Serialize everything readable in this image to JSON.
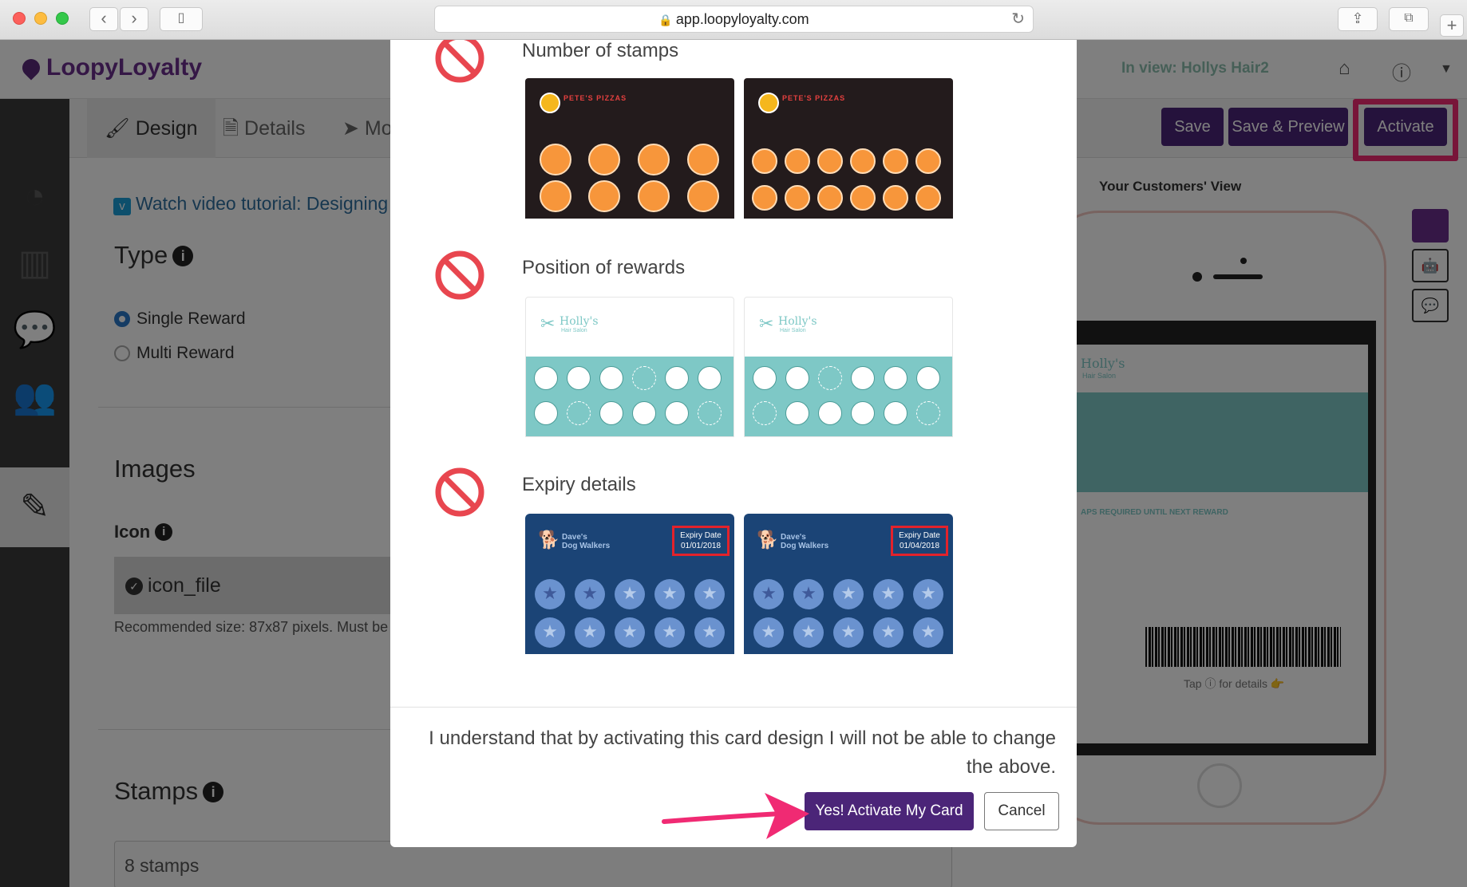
{
  "browser": {
    "url": "app.loopyloyalty.com"
  },
  "header": {
    "logo_text": "LoopyLoyalty",
    "in_view": "In view: Hollys Hair2"
  },
  "tabs": [
    {
      "label": "Design",
      "icon": "paintbrush-icon"
    },
    {
      "label": "Details",
      "icon": "document-icon"
    },
    {
      "label": "Mo",
      "icon": "navigation-arrow-icon"
    }
  ],
  "toolbar": {
    "save_label": "Save",
    "save_preview_label": "Save & Preview",
    "activate_label": "Activate"
  },
  "editor": {
    "watch_link": "Watch video tutorial: Designing",
    "type_heading": "Type",
    "radio_single": "Single Reward",
    "radio_multi": "Multi Reward",
    "images_heading": "Images",
    "icon_label": "Icon",
    "icon_file": "icon_file",
    "recommended": "Recommended size: 87x87 pixels. Must be s",
    "stamps_heading": "Stamps",
    "stamps_value": "8 stamps"
  },
  "preview": {
    "title": "Your Customers' View",
    "card_brand": "Holly's",
    "card_sub": "Hair Salon",
    "stamps_required": "APS REQUIRED UNTIL NEXT REWARD",
    "tap_text": "Tap ⓘ for details 👉"
  },
  "modal": {
    "sections": [
      {
        "title": "Number of stamps"
      },
      {
        "title": "Position of rewards"
      },
      {
        "title": "Expiry details"
      }
    ],
    "pizza_brand": "PETE'S PIZZAS",
    "holly_brand": "Holly's",
    "holly_sub": "Hair Salon",
    "dave_brand_1": "Dave's",
    "dave_brand_2": "Dog Walkers",
    "expiry_label": "Expiry Date",
    "expiry_date_left": "01/01/2018",
    "expiry_date_right": "01/04/2018",
    "understand_text": "I understand that by activating this card design I will not be able to change the above.",
    "confirm_label": "Yes! Activate My Card",
    "cancel_label": "Cancel"
  },
  "colors": {
    "brand_purple": "#4b2578",
    "highlight_pink": "#f02a73",
    "forbidden_red": "#e8464f",
    "teal": "#7ec8c6"
  }
}
